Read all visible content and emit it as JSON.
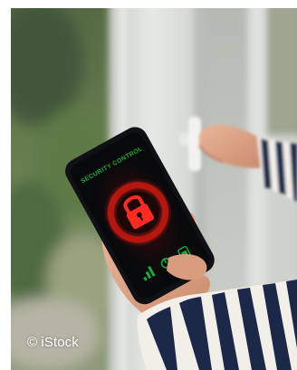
{
  "phone_screen": {
    "status_text": "SECURITY CONTROL",
    "icon": "padlock-icon",
    "accent_color": "#e0201c",
    "status_color": "#1fa83a"
  },
  "credit": {
    "text": "© iStock"
  }
}
